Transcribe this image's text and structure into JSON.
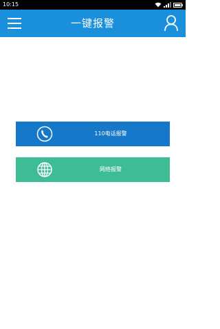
{
  "status_bar": {
    "time": "10:15"
  },
  "app_bar": {
    "title": "一键报警",
    "menu_icon": "menu-icon",
    "profile_icon": "user-icon",
    "background_color": "#1a8fdc"
  },
  "actions": [
    {
      "label": "110电话报警",
      "icon": "phone-icon",
      "color": "#1578c9"
    },
    {
      "label": "网络报警",
      "icon": "globe-icon",
      "color": "#3dbc96"
    }
  ]
}
